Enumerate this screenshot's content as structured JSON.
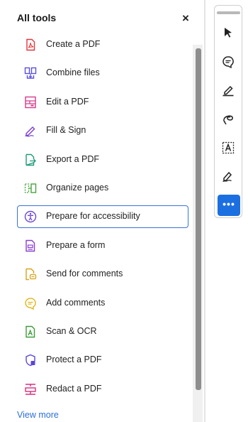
{
  "panel": {
    "title": "All tools",
    "close_icon": "close-icon",
    "view_more": "View more",
    "tools": [
      {
        "label": "Create a PDF",
        "icon": "create-pdf-icon",
        "color": "#e0373c"
      },
      {
        "label": "Combine files",
        "icon": "combine-files-icon",
        "color": "#5a4fe0"
      },
      {
        "label": "Edit a PDF",
        "icon": "edit-pdf-icon",
        "color": "#d63a8c"
      },
      {
        "label": "Fill & Sign",
        "icon": "fill-sign-icon",
        "color": "#7a3fd8"
      },
      {
        "label": "Export a PDF",
        "icon": "export-pdf-icon",
        "color": "#1f9b78"
      },
      {
        "label": "Organize pages",
        "icon": "organize-pages-icon",
        "color": "#47a43e"
      },
      {
        "label": "Prepare for accessibility",
        "icon": "accessibility-icon",
        "color": "#6d45d6",
        "selected": true
      },
      {
        "label": "Prepare a form",
        "icon": "prepare-form-icon",
        "color": "#8a3fd0"
      },
      {
        "label": "Send for comments",
        "icon": "send-comments-icon",
        "color": "#d9a21a"
      },
      {
        "label": "Add comments",
        "icon": "add-comments-icon",
        "color": "#e0b619"
      },
      {
        "label": "Scan & OCR",
        "icon": "scan-ocr-icon",
        "color": "#3d9b3a"
      },
      {
        "label": "Protect a PDF",
        "icon": "protect-pdf-icon",
        "color": "#5a45d6"
      },
      {
        "label": "Redact a PDF",
        "icon": "redact-pdf-icon",
        "color": "#d6317e"
      }
    ]
  },
  "rail": {
    "buttons": [
      {
        "icon": "select-cursor-icon"
      },
      {
        "icon": "comment-icon"
      },
      {
        "icon": "highlight-pen-icon"
      },
      {
        "icon": "draw-freehand-icon"
      },
      {
        "icon": "text-box-icon"
      },
      {
        "icon": "sign-icon"
      }
    ],
    "more_label": "•••",
    "more_color": "#1c6fe0"
  }
}
